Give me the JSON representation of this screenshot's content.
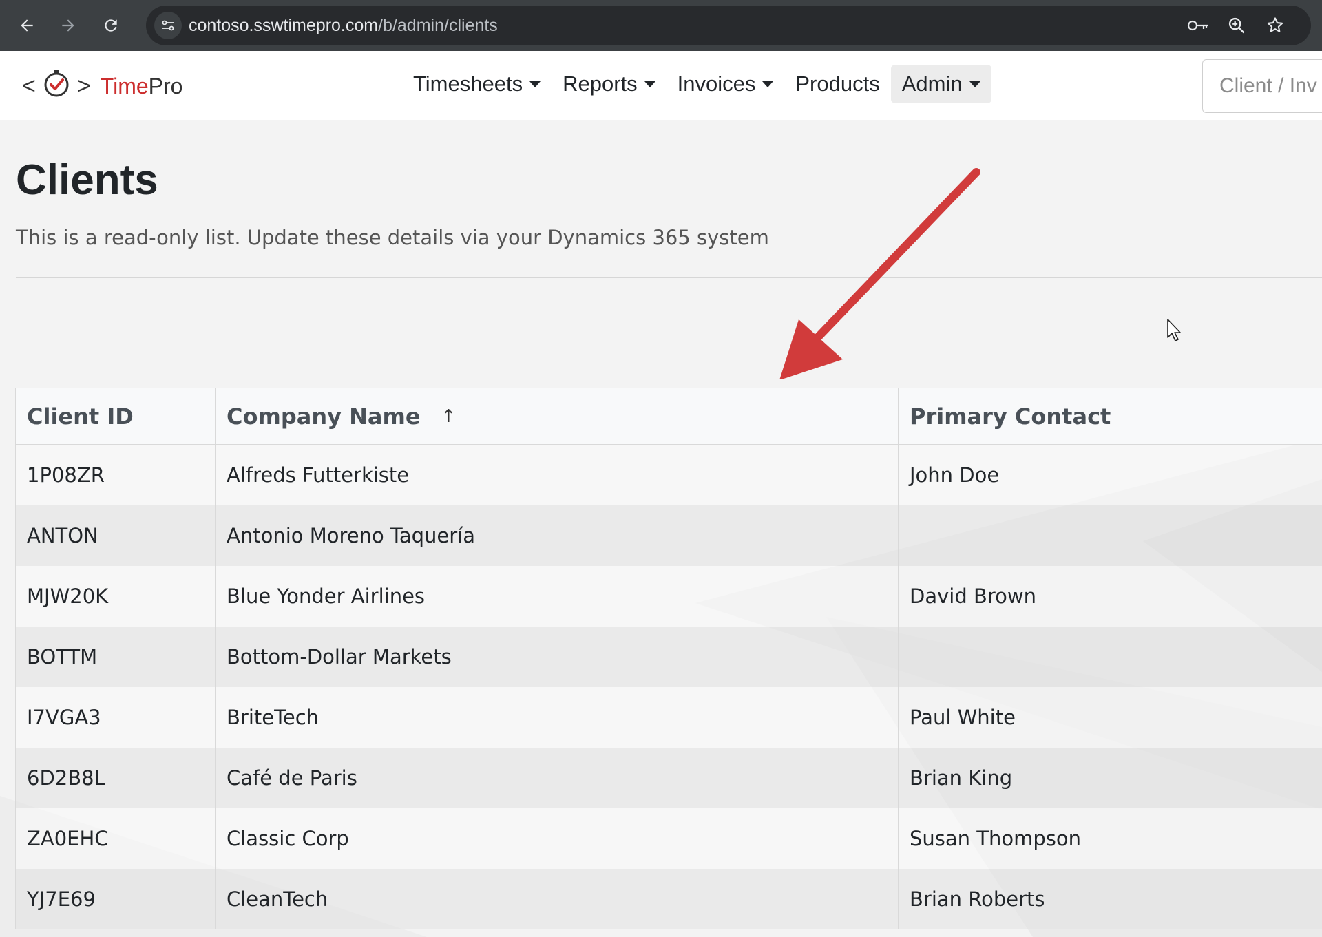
{
  "browser": {
    "url_host": "contoso.sswtimepro.com",
    "url_path": "/b/admin/clients",
    "icons": [
      "back-icon",
      "forward-icon",
      "reload-icon",
      "site-settings-icon",
      "password-key-icon",
      "zoom-icon",
      "bookmark-star-icon"
    ]
  },
  "header": {
    "brand": {
      "time": "Time",
      "pro": "Pro",
      "open_bracket": "<",
      "close_bracket": ">"
    },
    "nav": [
      {
        "label": "Timesheets",
        "dropdown": true
      },
      {
        "label": "Reports",
        "dropdown": true
      },
      {
        "label": "Invoices",
        "dropdown": true
      },
      {
        "label": "Products",
        "dropdown": false
      },
      {
        "label": "Admin",
        "dropdown": true,
        "active": true
      }
    ],
    "search_placeholder": "Client / Inv"
  },
  "page": {
    "title": "Clients",
    "subtitle": "This is a read-only list. Update these details via your Dynamics 365 system"
  },
  "table": {
    "columns": [
      {
        "label": "Client ID"
      },
      {
        "label": "Company Name",
        "sort": "↑"
      },
      {
        "label": "Primary Contact"
      }
    ],
    "rows": [
      {
        "id": "1P08ZR",
        "company": "Alfreds Futterkiste",
        "contact": "John Doe"
      },
      {
        "id": "ANTON",
        "company": "Antonio Moreno Taquería",
        "contact": ""
      },
      {
        "id": "MJW20K",
        "company": "Blue Yonder Airlines",
        "contact": "David Brown"
      },
      {
        "id": "BOTTM",
        "company": "Bottom-Dollar Markets",
        "contact": ""
      },
      {
        "id": "I7VGA3",
        "company": "BriteTech",
        "contact": "Paul White"
      },
      {
        "id": "6D2B8L",
        "company": "Café de Paris",
        "contact": "Brian King"
      },
      {
        "id": "ZA0EHC",
        "company": "Classic Corp",
        "contact": "Susan Thompson"
      },
      {
        "id": "YJ7E69",
        "company": "CleanTech",
        "contact": "Brian Roberts"
      }
    ]
  },
  "colors": {
    "brand_red": "#cc2e2e",
    "annotation_arrow": "#d13b3b",
    "chrome_dark": "#3c4043"
  }
}
